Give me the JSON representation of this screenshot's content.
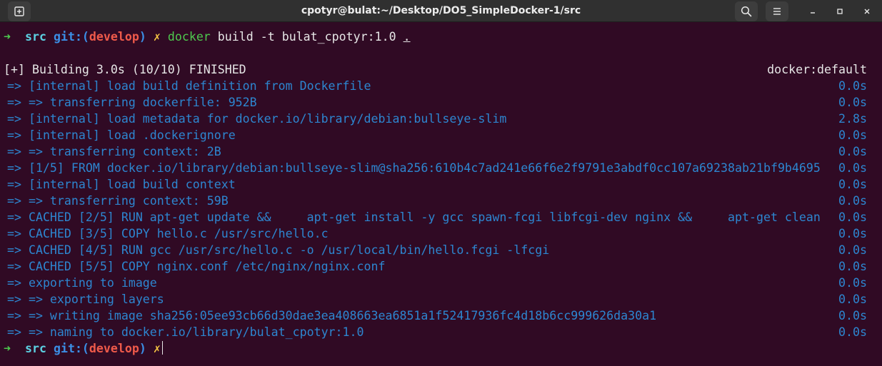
{
  "window": {
    "title": "cpotyr@bulat:~/Desktop/DO5_SimpleDocker-1/src",
    "new_tab_icon": "new-tab-icon",
    "search_icon": "search-icon",
    "menu_icon": "hamburger-menu-icon",
    "minimize_icon": "minimize-icon",
    "maximize_icon": "maximize-icon",
    "close_icon": "close-icon"
  },
  "prompt": {
    "arrow": "➜",
    "dir": "src",
    "git_prefix": "git:(",
    "branch": "develop",
    "git_suffix": ")",
    "dirty": "✗"
  },
  "command": {
    "program": "docker",
    "args": " build -t bulat_cpotyr:1.0 ",
    "context": "."
  },
  "build": {
    "header": "[+] Building 3.0s (10/10) FINISHED",
    "driver": "docker:default",
    "steps": [
      {
        "text": " => [internal] load build definition from Dockerfile",
        "time": "0.0s"
      },
      {
        "text": " => => transferring dockerfile: 952B",
        "time": "0.0s"
      },
      {
        "text": " => [internal] load metadata for docker.io/library/debian:bullseye-slim",
        "time": "2.8s"
      },
      {
        "text": " => [internal] load .dockerignore",
        "time": "0.0s"
      },
      {
        "text": " => => transferring context: 2B",
        "time": "0.0s"
      },
      {
        "text": " => [1/5] FROM docker.io/library/debian:bullseye-slim@sha256:610b4c7ad241e66f6e2f9791e3abdf0cc107a69238ab21bf9b4695",
        "time": "0.0s"
      },
      {
        "text": " => [internal] load build context",
        "time": "0.0s"
      },
      {
        "text": " => => transferring context: 59B",
        "time": "0.0s"
      },
      {
        "text": " => CACHED [2/5] RUN apt-get update &&     apt-get install -y gcc spawn-fcgi libfcgi-dev nginx &&     apt-get clean",
        "time": "0.0s"
      },
      {
        "text": " => CACHED [3/5] COPY hello.c /usr/src/hello.c",
        "time": "0.0s"
      },
      {
        "text": " => CACHED [4/5] RUN gcc /usr/src/hello.c -o /usr/local/bin/hello.fcgi -lfcgi",
        "time": "0.0s"
      },
      {
        "text": " => CACHED [5/5] COPY nginx.conf /etc/nginx/nginx.conf",
        "time": "0.0s"
      },
      {
        "text": " => exporting to image",
        "time": "0.0s"
      },
      {
        "text": " => => exporting layers",
        "time": "0.0s"
      },
      {
        "text": " => => writing image sha256:05ee93cb66d30dae3ea408663ea6851a1f52417936fc4d18b6cc999626da30a1",
        "time": "0.0s"
      },
      {
        "text": " => => naming to docker.io/library/bulat_cpotyr:1.0",
        "time": "0.0s"
      }
    ]
  },
  "colors": {
    "background": "#300a24",
    "titlebar": "#303030",
    "step_blue": "#2d86d0",
    "prompt_green": "#4ec94e",
    "branch_red": "#ef5a4a",
    "dirty_yellow": "#f5c542"
  }
}
